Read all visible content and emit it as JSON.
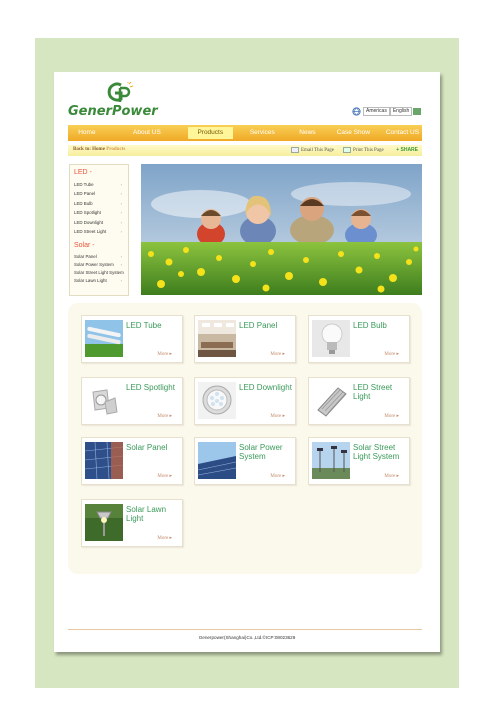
{
  "brand": {
    "name": "GenerPower",
    "colors": {
      "green": "#3a8a3a",
      "orange": "#f0a926",
      "red": "#e6533a"
    }
  },
  "lang": {
    "options": [
      "Americas",
      "English"
    ]
  },
  "nav": {
    "items": [
      "Home",
      "About US",
      "Products",
      "Services",
      "News",
      "Case Show",
      "Contact US"
    ],
    "active": "Products"
  },
  "breadcrumb": {
    "prefix": "Back to:",
    "home": "Home",
    "current": "Products"
  },
  "tools": {
    "email": "Email This Page",
    "print": "Print This Page",
    "share": "+ SHARE"
  },
  "sidebar": {
    "led_heading": "LED -",
    "led_items": [
      "LED Tube",
      "LED Panel",
      "LED Bulb",
      "LED Spotlight",
      "LED Downlight",
      "LED Street Light"
    ],
    "solar_heading": "Solar -",
    "solar_items": [
      "Solar Panel",
      "Solar Power System",
      "Solar Street Light System",
      "Solar Lawn Light"
    ],
    "arrow": "›"
  },
  "products": [
    {
      "title": "LED Tube",
      "more": "More ▸",
      "icon": "led-tube-icon"
    },
    {
      "title": "LED Panel",
      "more": "More ▸",
      "icon": "led-panel-icon"
    },
    {
      "title": "LED Bulb",
      "more": "More ▸",
      "icon": "led-bulb-icon"
    },
    {
      "title": "LED Spotlight",
      "more": "More ▸",
      "icon": "led-spotlight-icon"
    },
    {
      "title": "LED Downlight",
      "more": "More ▸",
      "icon": "led-downlight-icon"
    },
    {
      "title": "LED Street Light",
      "more": "More ▸",
      "icon": "led-street-light-icon"
    },
    {
      "title": "Solar Panel",
      "more": "More ▸",
      "icon": "solar-panel-icon"
    },
    {
      "title": "Solar Power System",
      "more": "More ▸",
      "icon": "solar-power-system-icon"
    },
    {
      "title": "Solar Street Light System",
      "more": "More ▸",
      "icon": "solar-street-light-icon"
    },
    {
      "title": "Solar Lawn Light",
      "more": "More ▸",
      "icon": "solar-lawn-light-icon"
    }
  ],
  "footer": {
    "text": "Generpower(Shanghai)Co.,Ltd.©ICP:08023629"
  }
}
